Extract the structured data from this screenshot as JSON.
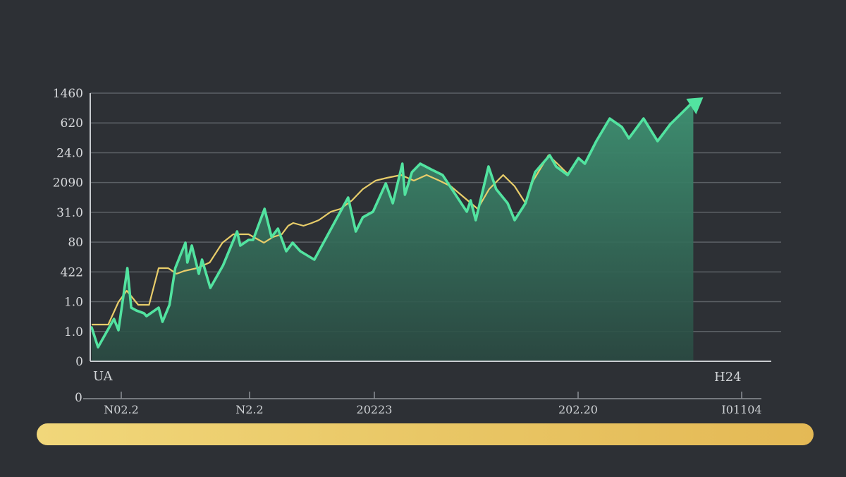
{
  "colors": {
    "background": "#2d3035",
    "line_primary": "#52e3a0",
    "line_secondary": "#e8cd6a",
    "area_fill": "#3b8a6c",
    "grid": "#5c6166",
    "axis": "#c9ccd0",
    "timeline_bar": "#e9c766"
  },
  "icons": {
    "trend_arrow": "arrow-up-right-icon"
  },
  "timeline": {
    "label": ""
  },
  "chart_data": {
    "type": "area",
    "title": "",
    "xlabel": "",
    "ylabel": "",
    "grid": true,
    "legend": "none",
    "y_tick_labels": [
      "0",
      "1.0",
      "1.0",
      "422",
      "80",
      "31.0",
      "2090",
      "24.0",
      "620",
      "1460"
    ],
    "x_tick_labels": [
      "N02.2",
      "N2.2",
      "20223",
      "202.20",
      "I01104"
    ],
    "corner_labels": {
      "left": "UA",
      "right": "H24",
      "bottom_left": "0"
    },
    "x_range": [
      0,
      100
    ],
    "y_range": [
      0,
      9.5
    ],
    "series": [
      {
        "values": [
          [
            0,
            1.2
          ],
          [
            1,
            0.5
          ],
          [
            2,
            0.9
          ],
          [
            3.5,
            1.5
          ],
          [
            4.2,
            1.1
          ],
          [
            5.6,
            3.3
          ],
          [
            6.2,
            1.9
          ],
          [
            7,
            1.8
          ],
          [
            8.2,
            1.7
          ],
          [
            8.6,
            1.6
          ],
          [
            10.5,
            1.9
          ],
          [
            11.1,
            1.4
          ],
          [
            12.2,
            2.0
          ],
          [
            13.1,
            3.3
          ],
          [
            14.7,
            4.2
          ],
          [
            15,
            3.5
          ],
          [
            15.7,
            4.1
          ],
          [
            16.8,
            3.1
          ],
          [
            17.3,
            3.6
          ],
          [
            18.6,
            2.6
          ],
          [
            20.6,
            3.4
          ],
          [
            22.8,
            4.6
          ],
          [
            23.3,
            4.1
          ],
          [
            24.6,
            4.3
          ],
          [
            25.3,
            4.3
          ],
          [
            27.1,
            5.4
          ],
          [
            28.2,
            4.4
          ],
          [
            29.2,
            4.7
          ],
          [
            30.5,
            3.9
          ],
          [
            31.5,
            4.2
          ],
          [
            32.7,
            3.9
          ],
          [
            34.9,
            3.6
          ],
          [
            38.5,
            5.1
          ],
          [
            40.2,
            5.8
          ],
          [
            41.4,
            4.6
          ],
          [
            42.5,
            5.1
          ],
          [
            44.1,
            5.3
          ],
          [
            46.1,
            6.3
          ],
          [
            47.2,
            5.6
          ],
          [
            48.7,
            7.0
          ],
          [
            49.1,
            5.9
          ],
          [
            50.2,
            6.7
          ],
          [
            51.5,
            7.0
          ],
          [
            53.2,
            6.8
          ],
          [
            55,
            6.6
          ],
          [
            58.8,
            5.3
          ],
          [
            59.4,
            5.7
          ],
          [
            60.2,
            5.0
          ],
          [
            62.2,
            6.9
          ],
          [
            63.4,
            6.1
          ],
          [
            65.2,
            5.6
          ],
          [
            66.3,
            5.0
          ],
          [
            68,
            5.6
          ],
          [
            69.5,
            6.7
          ],
          [
            71.8,
            7.3
          ],
          [
            72.8,
            6.9
          ],
          [
            74.6,
            6.6
          ],
          [
            76.3,
            7.2
          ],
          [
            77.3,
            7.0
          ],
          [
            79.1,
            7.8
          ],
          [
            81.2,
            8.6
          ],
          [
            83.1,
            8.3
          ],
          [
            84.2,
            7.9
          ],
          [
            86.5,
            8.6
          ],
          [
            88.7,
            7.8
          ],
          [
            90.7,
            8.4
          ],
          [
            94.3,
            9.2
          ]
        ]
      },
      {
        "values": [
          [
            0,
            1.3
          ],
          [
            2.6,
            1.3
          ],
          [
            4.2,
            2.1
          ],
          [
            5.5,
            2.5
          ],
          [
            7.3,
            2.0
          ],
          [
            9.0,
            2.0
          ],
          [
            10.5,
            3.3
          ],
          [
            12.0,
            3.3
          ],
          [
            13.3,
            3.1
          ],
          [
            14.5,
            3.2
          ],
          [
            16.5,
            3.3
          ],
          [
            18.5,
            3.5
          ],
          [
            20.5,
            4.2
          ],
          [
            22.2,
            4.5
          ],
          [
            24.6,
            4.5
          ],
          [
            27.0,
            4.2
          ],
          [
            28.4,
            4.4
          ],
          [
            29.8,
            4.5
          ],
          [
            30.8,
            4.8
          ],
          [
            31.6,
            4.9
          ],
          [
            33.2,
            4.8
          ],
          [
            34.5,
            4.9
          ],
          [
            35.6,
            5.0
          ],
          [
            37.5,
            5.3
          ],
          [
            39.0,
            5.4
          ],
          [
            40.8,
            5.7
          ],
          [
            42.5,
            6.1
          ],
          [
            44.5,
            6.4
          ],
          [
            46.3,
            6.5
          ],
          [
            48.5,
            6.6
          ],
          [
            50.5,
            6.4
          ],
          [
            52.5,
            6.6
          ],
          [
            54.5,
            6.4
          ],
          [
            56.3,
            6.2
          ],
          [
            58.4,
            5.8
          ],
          [
            60.5,
            5.4
          ],
          [
            62.3,
            6.1
          ],
          [
            64.5,
            6.6
          ],
          [
            66.3,
            6.2
          ],
          [
            68,
            5.6
          ],
          [
            69.2,
            6.4
          ],
          [
            71.6,
            7.3
          ],
          [
            73.0,
            7.0
          ],
          [
            74.8,
            6.6
          ]
        ]
      }
    ]
  }
}
